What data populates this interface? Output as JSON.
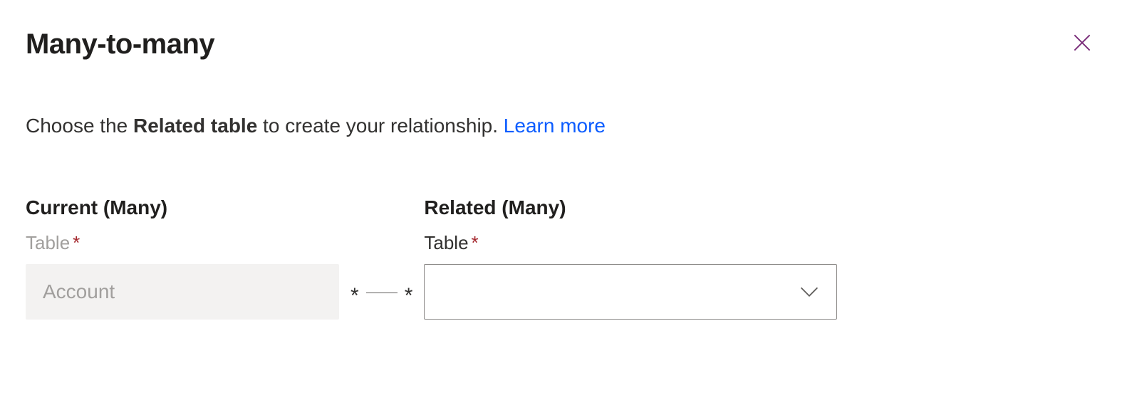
{
  "dialog": {
    "title": "Many-to-many",
    "description_prefix": "Choose the ",
    "description_bold": "Related table",
    "description_suffix": " to create your relationship. ",
    "learn_more_label": "Learn more"
  },
  "current": {
    "section_label": "Current (Many)",
    "field_label": "Table",
    "required_mark": "*",
    "value": "Account"
  },
  "connector": {
    "left_star": "*",
    "right_star": "*"
  },
  "related": {
    "section_label": "Related (Many)",
    "field_label": "Table",
    "required_mark": "*",
    "value": ""
  }
}
